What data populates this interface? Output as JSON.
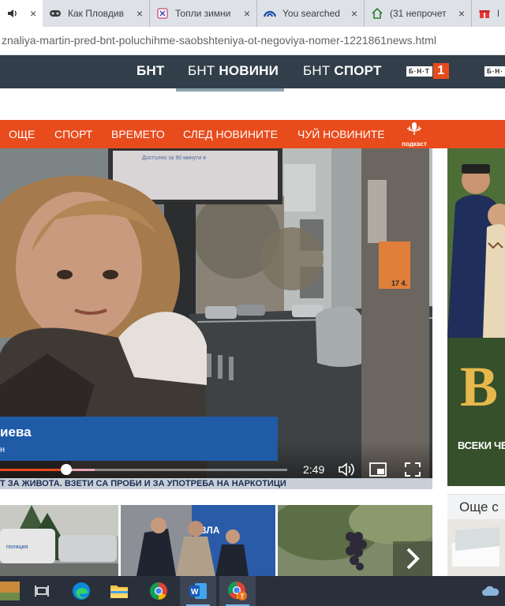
{
  "browser": {
    "tabs": [
      {
        "icon": "speaker-icon",
        "title": "",
        "close": "×"
      },
      {
        "icon": "gamepad-icon",
        "title": "Как Пловдив",
        "close": "×"
      },
      {
        "icon": "tg-logo-icon",
        "title": "Топли зимни",
        "close": "×"
      },
      {
        "icon": "wave-logo-icon",
        "title": "You searched",
        "close": "×"
      },
      {
        "icon": "home-icon",
        "title": "(31 непрочет",
        "close": "×"
      },
      {
        "icon": "gift-icon",
        "title": "П",
        "close": ""
      }
    ],
    "url": "znaliya-martin-pred-bnt-poluchihme-saobshteniya-ot-negoviya-nomer-1221861news.html"
  },
  "site_nav": {
    "items": [
      {
        "thin": "БНТ",
        "bold": ""
      },
      {
        "thin": "БНТ ",
        "bold": "НОВИНИ"
      },
      {
        "thin": "БНТ ",
        "bold": "СПОРТ"
      }
    ],
    "bnt1_logo": {
      "word": "Б·Н·Т",
      "number": "1"
    },
    "bnt2_logo": "Б·Н·"
  },
  "category_nav": {
    "items": [
      "ОЩЕ",
      "СПОРТ",
      "ВРЕМЕТО",
      "СЛЕД НОВИНИТЕ",
      "ЧУЙ НОВИНИТЕ"
    ],
    "podcast_label": "подкаст"
  },
  "video": {
    "lower_third_name": "иева",
    "lower_third_role": "н",
    "ticker": "Т ЗА ЖИВОТА. ВЗЕТИ СА ПРОБИ И ЗА УПОТРЕБА НА НАРКОТИЦИ",
    "poster_text": "Достъпно за 90 минути в",
    "sign_price": "17 4.",
    "current_time": "2:49",
    "progress_played": 0.23,
    "progress_buffered": 0.33,
    "controls": [
      "volume-icon",
      "picture-in-picture-icon",
      "fullscreen-icon"
    ]
  },
  "ad": {
    "letter": "B",
    "caption": "ВСЕКИ ЧЕТ"
  },
  "more_section": {
    "title": "Още с"
  },
  "thumbnails": {
    "police_van_text": "ВЛА",
    "car_text": "полиция"
  },
  "taskbar": {
    "items": [
      "task-view-icon",
      "edge-icon",
      "file-explorer-icon",
      "chrome-icon",
      "word-icon",
      "chrome-profile-icon"
    ],
    "word_label": "W",
    "profile_badge": "T"
  },
  "colors": {
    "nav_dark": "#323f4a",
    "brand_orange": "#e84b1c",
    "lower_third_blue": "#1f5ba7",
    "ad_gold": "#e7b84b"
  }
}
